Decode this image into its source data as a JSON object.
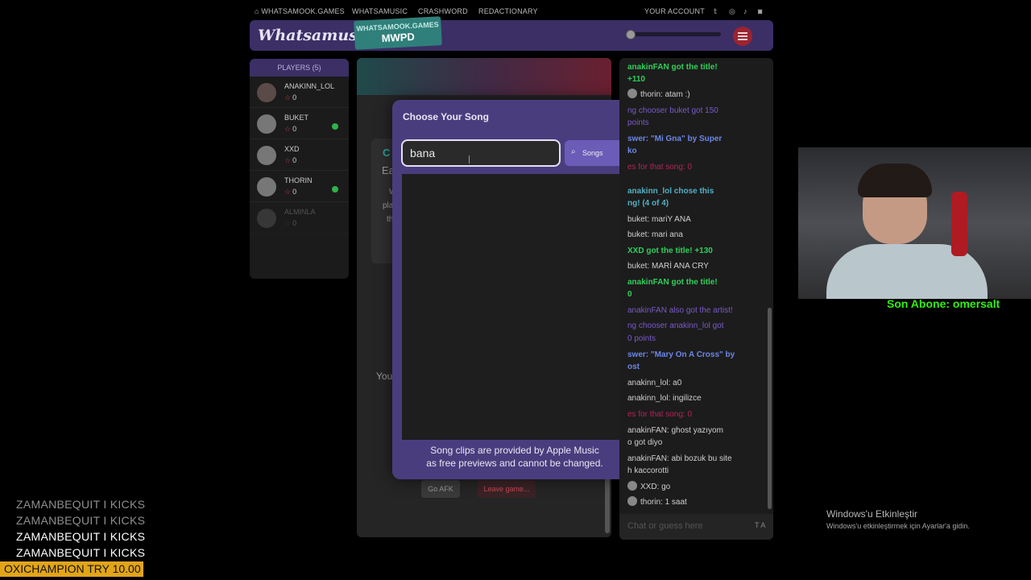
{
  "topnav": {
    "home": "WHATSAMOOK.GAMES",
    "link1": "WHATSAMUSIC",
    "link2": "CRASHWORD",
    "link3": "REDACTIONARY",
    "account": "YOUR ACCOUNT",
    "social_icons": [
      "twitter-icon",
      "instagram-icon",
      "tiktok-icon",
      "discord-icon"
    ]
  },
  "header": {
    "logo": "Whatsamusic",
    "badge_line1": "WHATSAMOOK.GAMES",
    "badge_line2": "MWPD"
  },
  "players": {
    "title": "PLAYERS (5)",
    "list": [
      {
        "name": "ANAKINN_LOL",
        "score": "0",
        "ready": false
      },
      {
        "name": "BUKET",
        "score": "0",
        "ready": true
      },
      {
        "name": "XXD",
        "score": "0",
        "ready": false
      },
      {
        "name": "THORIN",
        "score": "0",
        "ready": true
      },
      {
        "name": "ALMINLA",
        "score": "0",
        "ready": false
      }
    ]
  },
  "game": {
    "behind_c": "C",
    "behind_ea": "Ea",
    "behind_w": "W",
    "behind_pl": "pla",
    "behind_th": "th",
    "behind_you": "You",
    "afk_label": "Go AFK",
    "leave_label": "Leave game..."
  },
  "modal": {
    "title": "Choose Your Song",
    "search_value": "bana",
    "filter_label": "Songs",
    "note_line1": "Song clips are provided by Apple Music",
    "note_line2": "as free previews and cannot be changed."
  },
  "chat": {
    "placeholder": "Chat or guess here",
    "lines": [
      {
        "t": "anakinFAN got the title!",
        "style": "g"
      },
      {
        "t": "+110",
        "style": "g"
      },
      {
        "t": "thorin: atam :)",
        "style": "n"
      },
      {
        "t": "ng chooser buket got 150",
        "style": "p"
      },
      {
        "t": "points",
        "style": "p"
      },
      {
        "t": "swer: \"Mi Gna\" by Super",
        "style": "b"
      },
      {
        "t": "ko",
        "style": "b"
      },
      {
        "t": "es for that song: 0",
        "style": "r"
      },
      {
        "t": "anakinn_lol chose this",
        "style": "t"
      },
      {
        "t": "ng! (4 of 4)",
        "style": "t"
      },
      {
        "t": "buket: mariY ANA",
        "style": "n"
      },
      {
        "t": "buket: mari ana",
        "style": "n"
      },
      {
        "t": "XXD got the title! +130",
        "style": "g"
      },
      {
        "t": "buket: MARİ ANA CRY",
        "style": "n"
      },
      {
        "t": "anakinFAN got the title!",
        "style": "g"
      },
      {
        "t": "0",
        "style": "g"
      },
      {
        "t": "anakinFAN also got the artist!",
        "style": "p"
      },
      {
        "t": "ng chooser anakinn_lol got",
        "style": "p"
      },
      {
        "t": "0 points",
        "style": "p"
      },
      {
        "t": "swer: \"Mary On A Cross\" by",
        "style": "b"
      },
      {
        "t": "ost",
        "style": "b"
      },
      {
        "t": "anakinn_lol: a0",
        "style": "n"
      },
      {
        "t": "anakinn_lol: ingilizce",
        "style": "n"
      },
      {
        "t": "es for that song: 0",
        "style": "r"
      },
      {
        "t": "anakinFAN: ghost yazıyom",
        "style": "n"
      },
      {
        "t": "o got diyo",
        "style": "n"
      },
      {
        "t": "anakinFAN: abi bozuk bu site",
        "style": "n"
      },
      {
        "t": "h kaccorotti",
        "style": "n"
      },
      {
        "t": "XXD: go",
        "style": "n"
      },
      {
        "t": "thorin: 1 saat",
        "style": "n"
      }
    ]
  },
  "overlay": {
    "subscriber": "Son Abone: omersalt",
    "kicks": [
      "ZAMANBEQUIT  I KICKS",
      "ZAMANBEQUIT  I KICKS",
      "ZAMANBEQUIT  I KICKS",
      "ZAMANBEQUIT  I KICKS"
    ],
    "donation": "OXICHAMPION  TRY 10.00"
  },
  "windows": {
    "line1": "Windows'u Etkinleştir",
    "line2": "Windows'u etkinleştirmek için Ayarlar'a gidin."
  }
}
